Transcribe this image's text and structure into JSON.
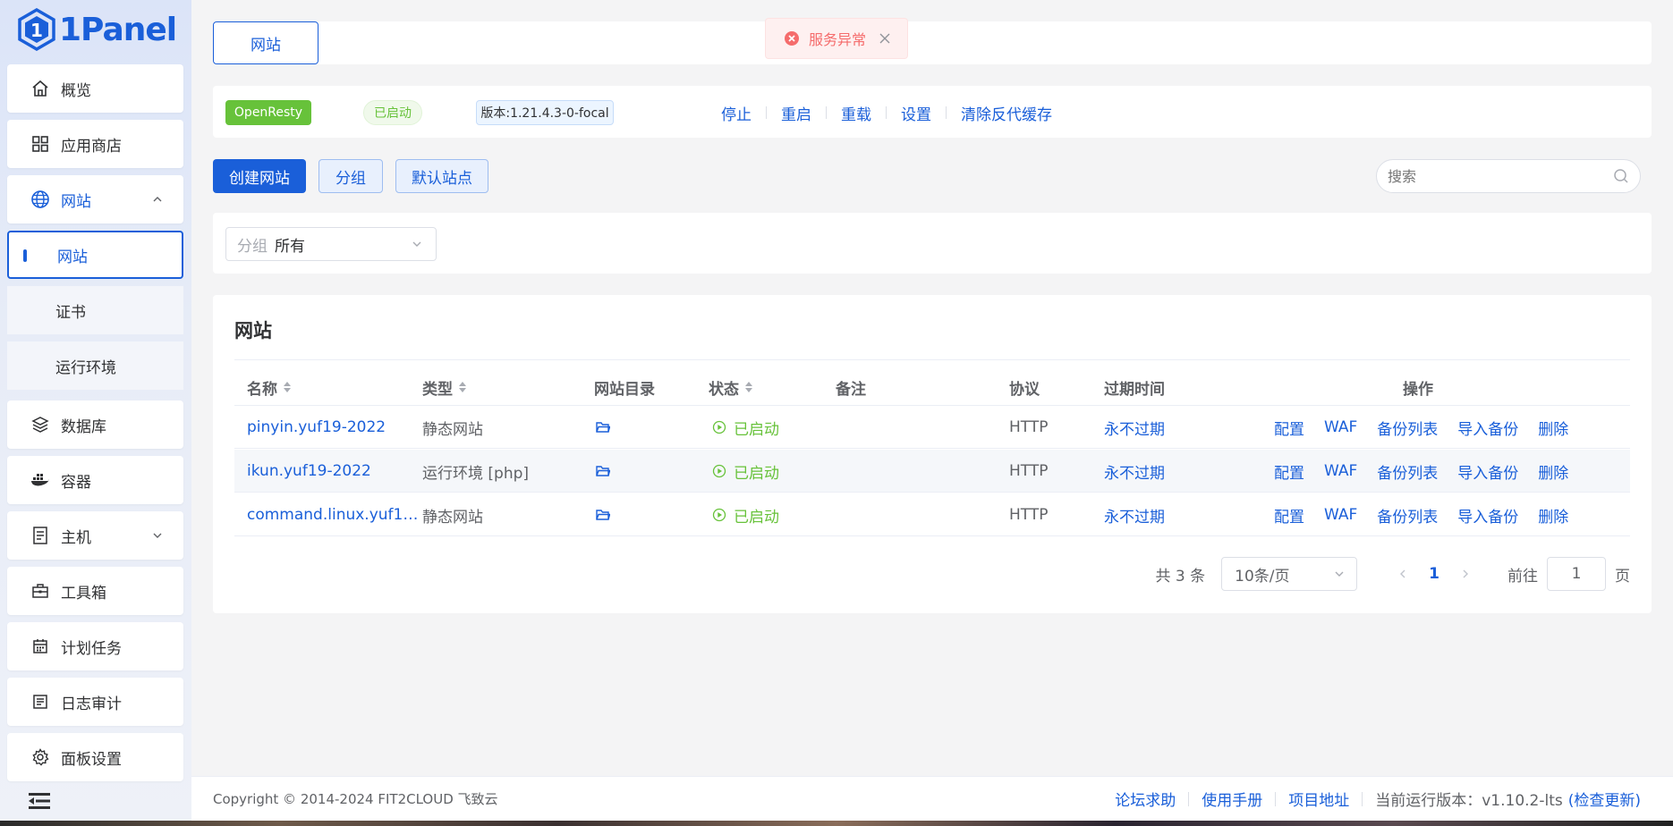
{
  "brand": {
    "name": "1Panel",
    "color": "#1a5fd9"
  },
  "sidebar": {
    "items": [
      {
        "label": "概览",
        "icon": "home-icon"
      },
      {
        "label": "应用商店",
        "icon": "apps-grid-icon"
      },
      {
        "label": "网站",
        "icon": "globe-icon",
        "expanded": true,
        "children": [
          {
            "label": "网站",
            "active": true
          },
          {
            "label": "证书"
          },
          {
            "label": "运行环境"
          }
        ]
      },
      {
        "label": "数据库",
        "icon": "layers-icon"
      },
      {
        "label": "容器",
        "icon": "docker-icon"
      },
      {
        "label": "主机",
        "icon": "server-icon",
        "expandable": true
      },
      {
        "label": "工具箱",
        "icon": "toolbox-icon"
      },
      {
        "label": "计划任务",
        "icon": "calendar-icon"
      },
      {
        "label": "日志审计",
        "icon": "log-icon"
      },
      {
        "label": "面板设置",
        "icon": "gear-icon"
      }
    ]
  },
  "tabs": {
    "active_tab": "网站"
  },
  "toast": {
    "message": "服务异常",
    "type": "error"
  },
  "app_bar": {
    "name": "OpenResty",
    "status": "已启动",
    "version": "版本:1.21.4.3-0-focal",
    "ops": [
      "停止",
      "重启",
      "重载",
      "设置",
      "清除反代缓存"
    ]
  },
  "toolbar": {
    "create_label": "创建网站",
    "group_label": "分组",
    "default_site_label": "默认站点",
    "search_placeholder": "搜索"
  },
  "filter": {
    "label": "分组",
    "value": "所有"
  },
  "table": {
    "title": "网站",
    "columns": {
      "name": "名称",
      "type": "类型",
      "dir": "网站目录",
      "status": "状态",
      "remark": "备注",
      "protocol": "协议",
      "expire": "过期时间",
      "ops": "操作"
    },
    "rows": [
      {
        "name": "pinyin.yuf19-2022",
        "type": "静态网站",
        "status": "已启动",
        "remark": "",
        "protocol": "HTTP",
        "expire": "永不过期"
      },
      {
        "name": "ikun.yuf19-2022",
        "type": "运行环境 [php]",
        "status": "已启动",
        "remark": "",
        "protocol": "HTTP",
        "expire": "永不过期"
      },
      {
        "name": "command.linux.yuf1…",
        "type": "静态网站",
        "status": "已启动",
        "remark": "",
        "protocol": "HTTP",
        "expire": "永不过期"
      }
    ],
    "row_actions": [
      "配置",
      "WAF",
      "备份列表",
      "导入备份",
      "删除"
    ]
  },
  "pagination": {
    "total_text": "共 3 条",
    "page_size": "10条/页",
    "current_page": "1",
    "goto_label": "前往",
    "goto_value": "1",
    "page_unit": "页"
  },
  "footer": {
    "copyright": "Copyright © 2014-2024 FIT2CLOUD 飞致云",
    "links": [
      "论坛求助",
      "使用手册",
      "项目地址"
    ],
    "version_text": "当前运行版本：v1.10.2-lts",
    "check_update": "(检查更新)"
  }
}
